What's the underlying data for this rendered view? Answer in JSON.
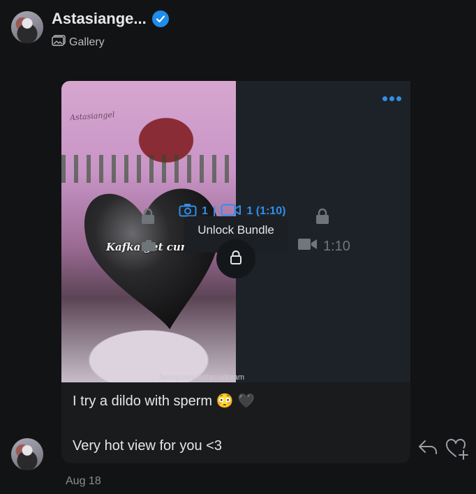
{
  "header": {
    "name": "Astasiange...",
    "section": "Gallery"
  },
  "post": {
    "overlay_text": "Kafka get cum ou",
    "watermark": "fansly.com/Astasiadream",
    "signature": "Astasiangel",
    "unlock": {
      "photos_count": "1",
      "separator": "|",
      "videos": "1 (1:10)",
      "label": "Unlock Bundle"
    },
    "video_duration": "1:10",
    "caption_line1": "I try a dildo with sperm 😳 🖤",
    "caption_line2": "Very hot view for you <3",
    "date": "Aug 18"
  },
  "colors": {
    "accent": "#2f8fe8",
    "background": "#121314",
    "card": "#1a1b1d"
  },
  "icons": {
    "verified": "verified-badge-icon",
    "gallery": "gallery-icon",
    "more": "more-options-icon",
    "lock": "lock-icon",
    "camera": "camera-icon",
    "video": "video-camera-icon",
    "reply": "reply-icon",
    "like": "heart-plus-icon",
    "heart_sticker": "black-heart-sticker"
  }
}
